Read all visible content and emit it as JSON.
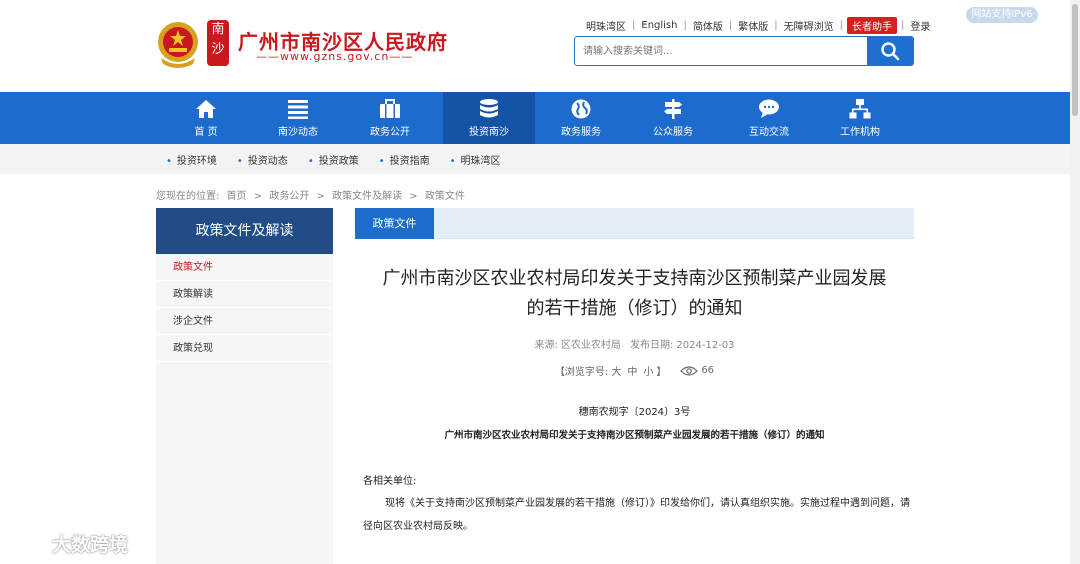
{
  "header": {
    "site_title": "广州市南沙区人民政府",
    "site_url": "——www.gzns.gov.cn——",
    "seal_text": "南沙",
    "ipv6_badge": "网站支持IPv6",
    "top_links": [
      "明珠湾区",
      "English",
      "简体版",
      "繁体版",
      "无障碍浏览"
    ],
    "elder_helper": "长者助手",
    "login": "登录",
    "search_placeholder": "请输入搜索关键词..."
  },
  "nav": {
    "items": [
      {
        "label": "首 页",
        "icon": "home-icon"
      },
      {
        "label": "南沙动态",
        "icon": "list-icon"
      },
      {
        "label": "政务公开",
        "icon": "briefcase-icon"
      },
      {
        "label": "投资南沙",
        "icon": "database-icon"
      },
      {
        "label": "政务服务",
        "icon": "globe-icon"
      },
      {
        "label": "公众服务",
        "icon": "signpost-icon"
      },
      {
        "label": "互动交流",
        "icon": "chat-icon"
      },
      {
        "label": "工作机构",
        "icon": "org-chart-icon"
      }
    ],
    "active_index": 3
  },
  "subnav": {
    "items": [
      "投资环境",
      "投资动态",
      "投资政策",
      "投资指南",
      "明珠湾区"
    ]
  },
  "breadcrumb": [
    "您现在的位置:",
    "首页",
    ">",
    "政务公开",
    ">",
    "政策文件及解读",
    ">",
    "政策文件"
  ],
  "sidebar": {
    "title": "政策文件及解读",
    "items": [
      "政策文件",
      "政策解读",
      "涉企文件",
      "政策兑现"
    ],
    "active_index": 0
  },
  "article": {
    "tab": "政策文件",
    "title_line1": "广州市南沙区农业农村局印发关于支持南沙区预制菜产业园发展",
    "title_line2": "的若干措施（修订）的通知",
    "source_label": "来源:",
    "source": "区农业农村局",
    "date_label": "发布日期:",
    "date": "2024-12-03",
    "font_size_label": "【浏览字号:",
    "font_sizes": [
      "大",
      "中",
      "小"
    ],
    "font_size_close": "】",
    "views": "66",
    "doc_no": "穗南农规字〔2024〕3号",
    "subtitle": "广州市南沙区农业农村局印发关于支持南沙区预制菜产业园发展的若干措施（修订）的通知",
    "salutation": "各相关单位:",
    "paragraph1": "现将《关于支持南沙区预制菜产业园发展的若干措施（修订）》印发给你们，请认真组织实施。实施过程中遇到问题，请径向区农业农村局反映。"
  },
  "watermark": "大数跨境",
  "colors": {
    "brand_red": "#c9181e",
    "nav_blue": "#1d6ccd",
    "nav_active": "#1553a6",
    "sidebar_title_bg": "#214c86"
  }
}
